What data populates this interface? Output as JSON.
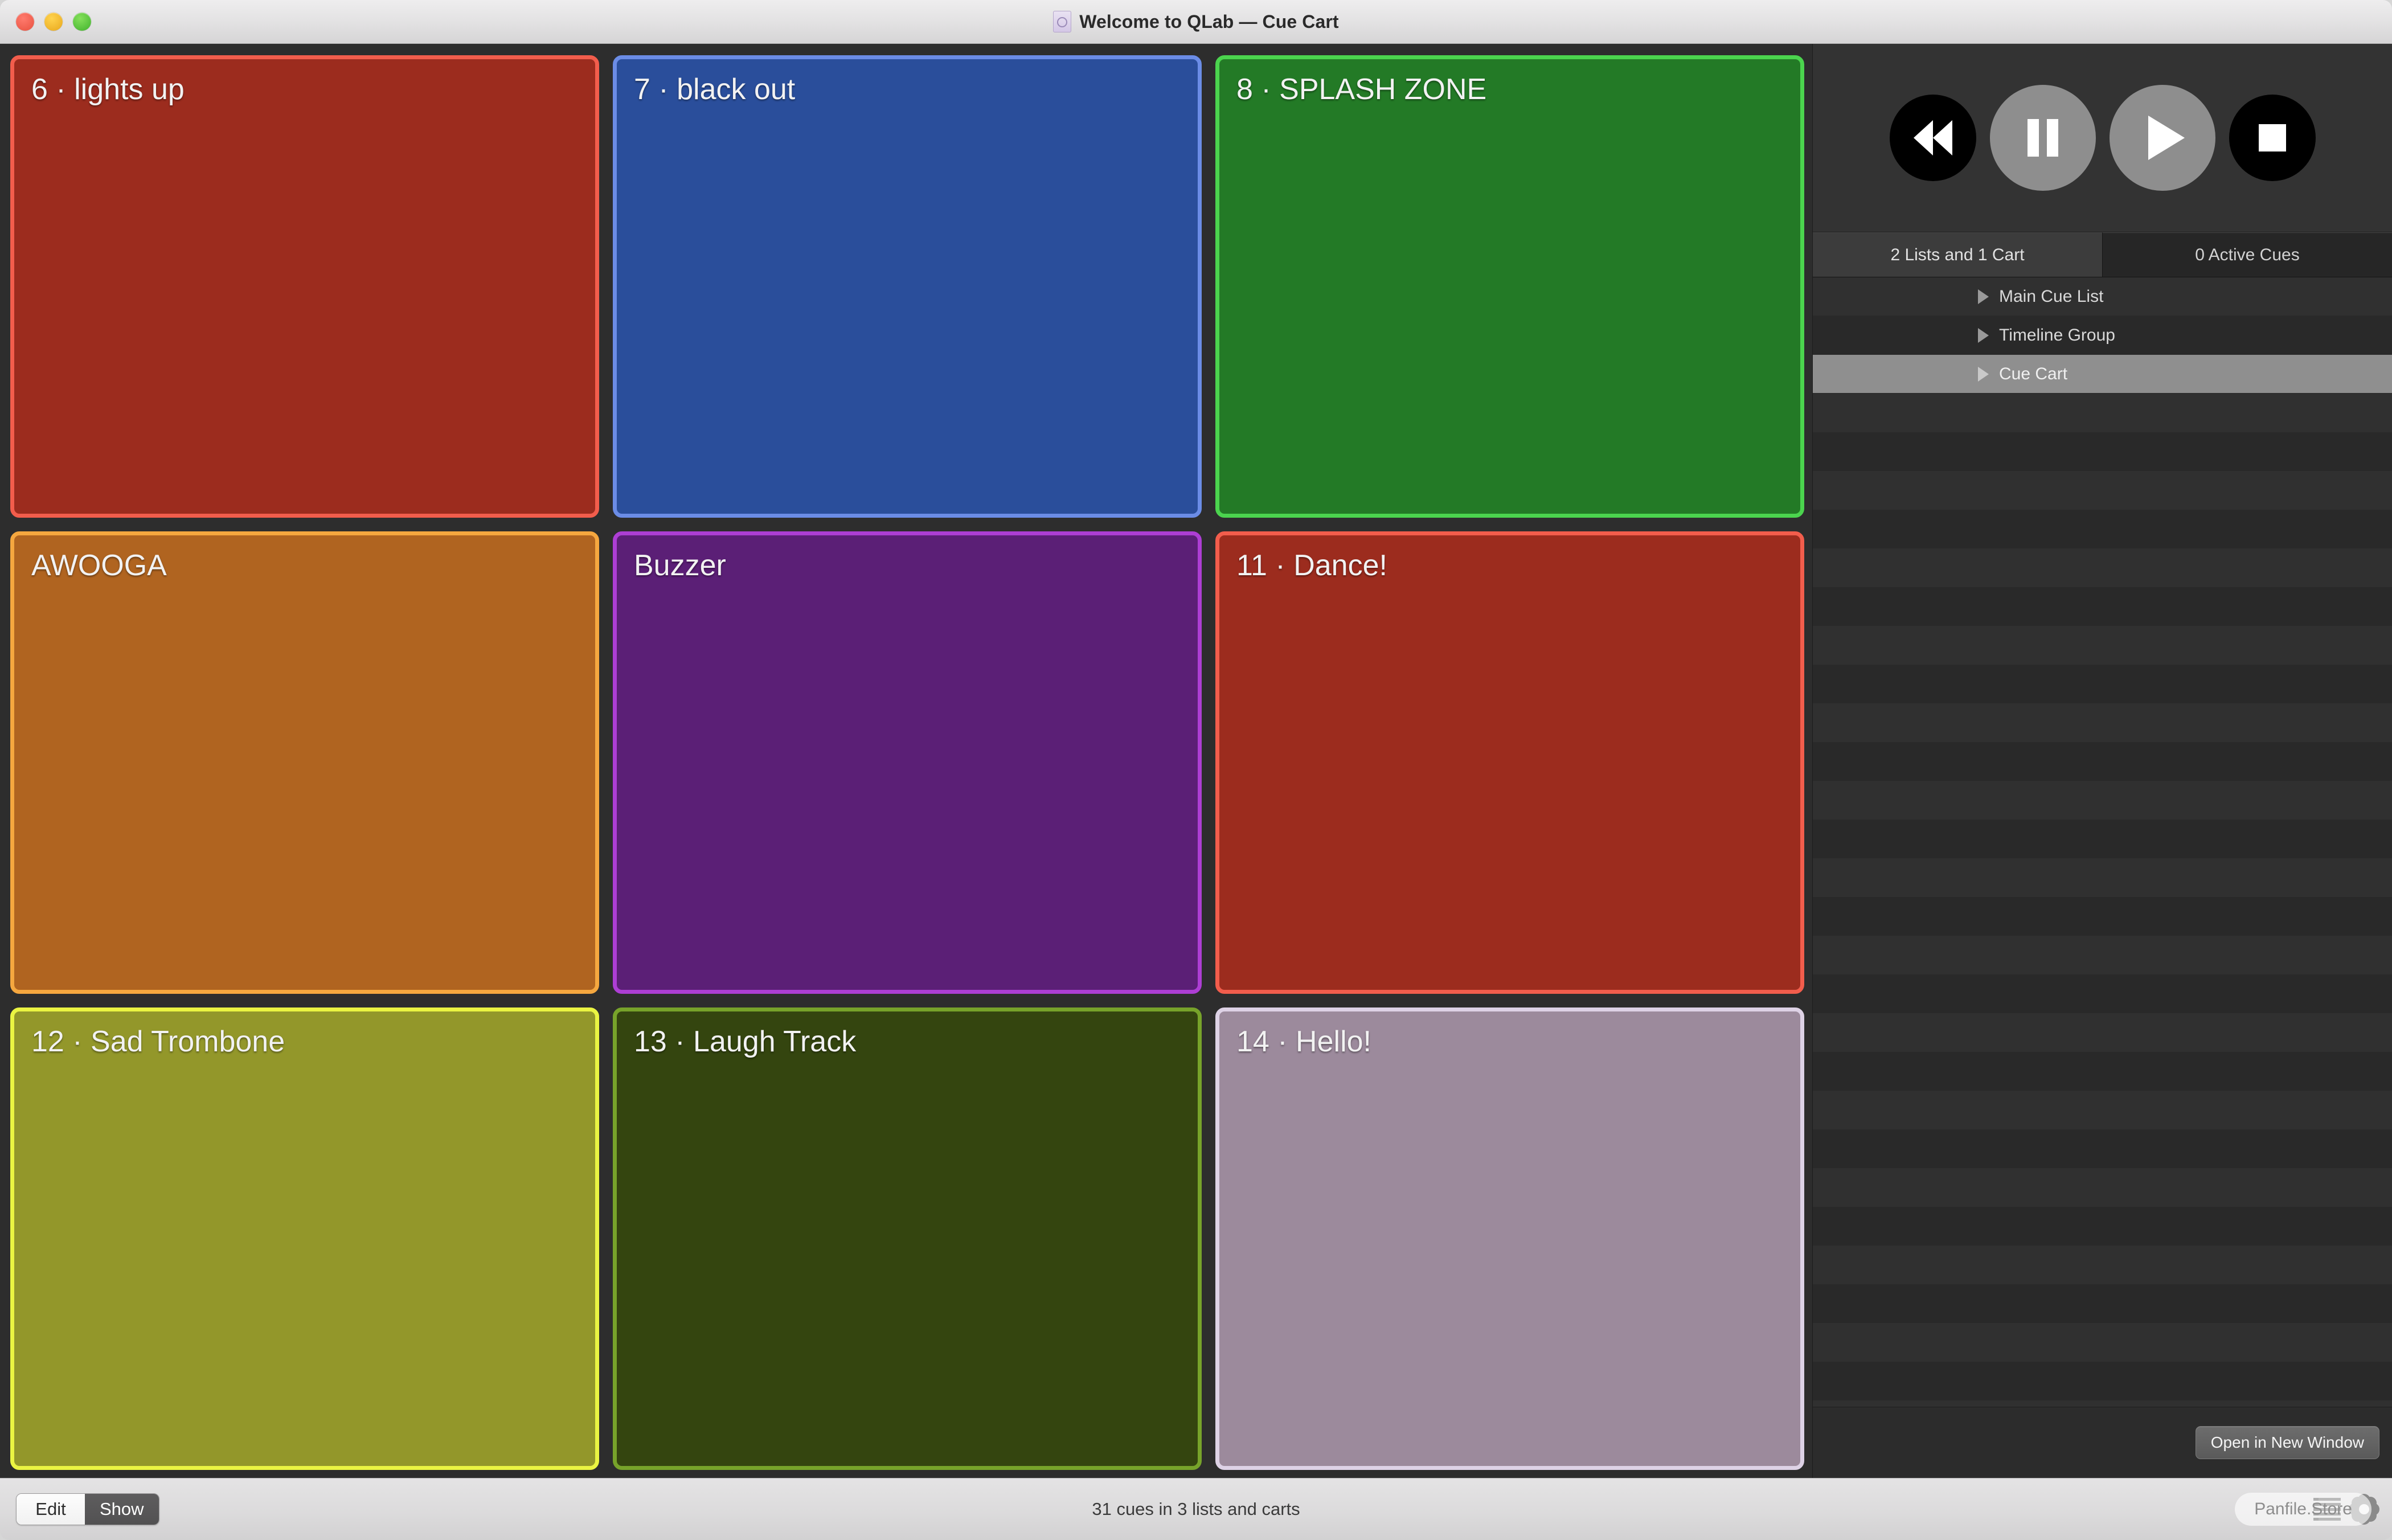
{
  "window": {
    "title": "Welcome to QLab — Cue Cart",
    "doc_icon": "document-icon",
    "traffic_lights": [
      "close",
      "minimize",
      "maximize"
    ]
  },
  "cue_cart": {
    "tiles": [
      {
        "label": "6 · lights up",
        "fill": "#9c2c1e",
        "border": "#f25d4c"
      },
      {
        "label": "7 · black out",
        "fill": "#2a4e9b",
        "border": "#6b8ce6"
      },
      {
        "label": "8 · SPLASH ZONE",
        "fill": "#237a26",
        "border": "#4bd44e"
      },
      {
        "label": "AWOOGA",
        "fill": "#b06420",
        "border": "#f5a73f"
      },
      {
        "label": "Buzzer",
        "fill": "#5b1f76",
        "border": "#ad3ed4"
      },
      {
        "label": "11 · Dance!",
        "fill": "#9c2c1e",
        "border": "#f25d4c"
      },
      {
        "label": "12 · Sad Trombone",
        "fill": "#93972a",
        "border": "#eaf442"
      },
      {
        "label": "13 · Laugh Track",
        "fill": "#34450f",
        "border": "#77a32a"
      },
      {
        "label": "14 · Hello!",
        "fill": "#9c8a9c",
        "border": "#ded2e6"
      }
    ]
  },
  "transport": {
    "buttons": [
      {
        "name": "rewind",
        "style": "dark"
      },
      {
        "name": "pause",
        "style": "light"
      },
      {
        "name": "play",
        "style": "light"
      },
      {
        "name": "stop",
        "style": "dark"
      }
    ]
  },
  "sidebar": {
    "tabs": [
      {
        "label": "2 Lists and 1 Cart",
        "active": true
      },
      {
        "label": "0 Active Cues",
        "active": false
      }
    ],
    "rows": [
      {
        "label": "Main Cue List",
        "selected": false
      },
      {
        "label": "Timeline Group",
        "selected": false
      },
      {
        "label": "Cue Cart",
        "selected": true
      }
    ],
    "open_new_window_label": "Open in New Window"
  },
  "bottom_bar": {
    "edit_label": "Edit",
    "show_label": "Show",
    "active_mode": "Show",
    "status": "31 cues in 3 lists and carts",
    "icons": [
      "list-icon",
      "gear-icon"
    ],
    "watermark": "Panfile.Store"
  }
}
